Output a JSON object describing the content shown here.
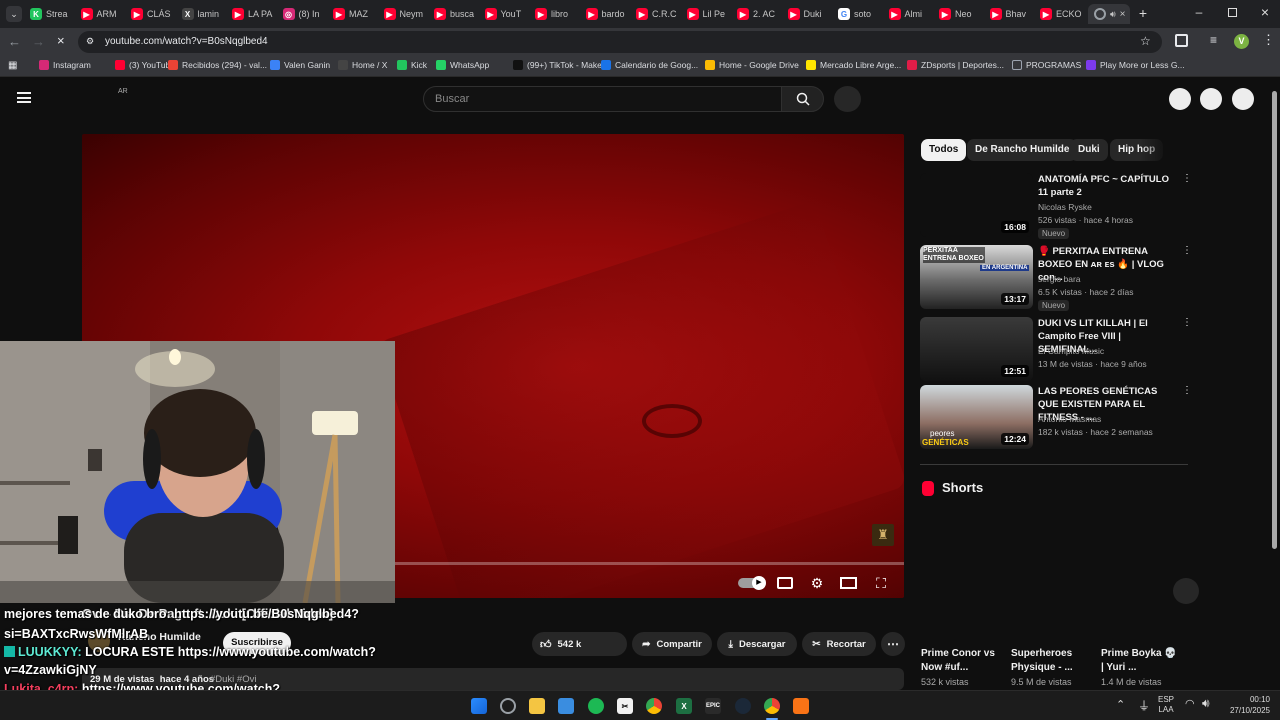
{
  "browser": {
    "tabs": [
      {
        "label": "Strea",
        "color": "#22c55e",
        "glyph": "K"
      },
      {
        "label": "ARM",
        "color": "#ff0033",
        "glyph": "▶"
      },
      {
        "label": "CLÁS",
        "color": "#ff0033",
        "glyph": "▶"
      },
      {
        "label": "lamin",
        "color": "#444444",
        "glyph": "X"
      },
      {
        "label": "LA PA",
        "color": "#ff0033",
        "glyph": "▶"
      },
      {
        "label": "(8) In",
        "color": "#d62976",
        "glyph": "◎"
      },
      {
        "label": "MAZ",
        "color": "#ff0033",
        "glyph": "▶"
      },
      {
        "label": "Neym",
        "color": "#ff0033",
        "glyph": "▶"
      },
      {
        "label": "busca",
        "color": "#ff0033",
        "glyph": "▶"
      },
      {
        "label": "YouT",
        "color": "#ff0033",
        "glyph": "▶"
      },
      {
        "label": "libro",
        "color": "#ff0033",
        "glyph": "▶"
      },
      {
        "label": "bardo",
        "color": "#ff0033",
        "glyph": "▶"
      },
      {
        "label": "C.R.C",
        "color": "#ff0033",
        "glyph": "▶"
      },
      {
        "label": "Lil Pe",
        "color": "#ff0033",
        "glyph": "▶"
      },
      {
        "label": "2. AC",
        "color": "#ff0033",
        "glyph": "▶"
      },
      {
        "label": "Duki",
        "color": "#ff0033",
        "glyph": "▶"
      },
      {
        "label": "soto",
        "color": "#ffffff",
        "glyph": "G"
      },
      {
        "label": "Almi",
        "color": "#ff0033",
        "glyph": "▶"
      },
      {
        "label": "Neo",
        "color": "#ff0033",
        "glyph": "▶"
      },
      {
        "label": "Bhav",
        "color": "#ff0033",
        "glyph": "▶"
      },
      {
        "label": "ECKO",
        "color": "#ff0033",
        "glyph": "▶"
      }
    ],
    "url": "youtube.com/watch?v=B0sNqglbed4",
    "profile_initial": "V",
    "bookmarks": [
      {
        "label": "Instagram",
        "color": "#d62976"
      },
      {
        "label": "(3) YouTube",
        "color": "#ff0033"
      },
      {
        "label": "Recibidos (294) - val...",
        "color": "#ea4335"
      },
      {
        "label": "Valen Ganin",
        "color": "#3b82f6"
      },
      {
        "label": "Home / X",
        "color": "#444444"
      },
      {
        "label": "Kick",
        "color": "#22c55e"
      },
      {
        "label": "WhatsApp",
        "color": "#25d366"
      },
      {
        "label": "(99+) TikTok - Make...",
        "color": "#111111"
      },
      {
        "label": "Calendario de Goog...",
        "color": "#1a73e8"
      },
      {
        "label": "Home - Google Drive",
        "color": "#fbbc04"
      },
      {
        "label": "Mercado Libre Arge...",
        "color": "#ffe600"
      },
      {
        "label": "ZDsports | Deportes...",
        "color": "#e11d48"
      },
      {
        "label": "PROGRAMAS",
        "color": "#9ca3af"
      },
      {
        "label": "Play More or Less G...",
        "color": "#7c3aed"
      }
    ]
  },
  "youtube": {
    "country": "AR",
    "search_placeholder": "Buscar",
    "chips": [
      "Todos",
      "De Rancho Humilde",
      "Duki",
      "Hip hop"
    ],
    "related": [
      {
        "title": "ANATOMÍA PFC ~ CAPÍTULO 11 parte 2",
        "channel": "Nicolas Ryske",
        "meta": "526 vistas · hace 4 horas",
        "duration": "16:08",
        "badge": "Nuevo"
      },
      {
        "title": "🥊 PERXITAA ENTRENA BOXEO EN ᴀʀ ᴇs 🔥 | VLOG con...",
        "channel": "sergio bara",
        "meta": "6.5 K vistas · hace 2 días",
        "duration": "13:17",
        "badge": "Nuevo"
      },
      {
        "title": "DUKI VS LIT KILLAH | El Campito Free VIII | SEMIFINAL...",
        "channel": "El Campito Music",
        "meta": "13 M de vistas · hace 9 años",
        "duration": "12:51",
        "badge": ""
      },
      {
        "title": "LAS PEORES GENÉTICAS QUE EXISTEN PARA EL FITNESS - ...",
        "channel": "Antonio Masmas",
        "meta": "182 k vistas · hace 2 semanas",
        "duration": "12:24",
        "badge": ""
      }
    ],
    "thumb_texts": {
      "perxitaa": "PERXITAA ENTRENA BOXEO",
      "argentina": "EN ARGENTINA",
      "peores": "peores",
      "geneticas": "GENÉTICAS"
    },
    "shorts_heading": "Shorts",
    "shorts": [
      {
        "title": "Prime Conor vs Now #uf...",
        "views": "532 k vistas"
      },
      {
        "title": "Superheroes Physique - ...",
        "views": "9.5 M de vistas"
      },
      {
        "title": "Prime Boyka 💀 | Yuri ...",
        "views": "1.4 M de vistas"
      }
    ],
    "video": {
      "title": "Ovi - Dia De Pago ft. Duki [Official Video]",
      "channel": "Rancho Humilde",
      "subscribe": "Suscribirse",
      "likes": "542 k",
      "share": "Compartir",
      "download": "Descargar",
      "clip": "Recortar",
      "stats": "29 M de vistas  hace 4 años",
      "tags": "#Duki #Ovi"
    }
  },
  "chat": [
    {
      "user": "",
      "text": "mejores temas de duko bro: https://youtu.be/B0sNqglbed4?",
      "color": "#ffffff"
    },
    {
      "user": "",
      "text": "si=BAXTxcRwsWfMlrAB",
      "color": "#ffffff"
    },
    {
      "user": "LUUKKYY:",
      "text": "LOCURA ESTE https://www.youtube.com/watch?",
      "color": "#5eead4"
    },
    {
      "user": "",
      "text": "v=4ZzawkiGjNY",
      "color": "#ffffff"
    },
    {
      "user": "Lukita_c4rp:",
      "text": "https://www.youtube.com/watch?",
      "color": "#f43f5e"
    },
    {
      "user": "",
      "text": "v=eAqeed4INns",
      "color": "#ffffff"
    }
  ],
  "taskbar": {
    "lang_top": "ESP",
    "lang_bottom": "LAA",
    "time": "00:10",
    "date": "27/10/2025"
  }
}
